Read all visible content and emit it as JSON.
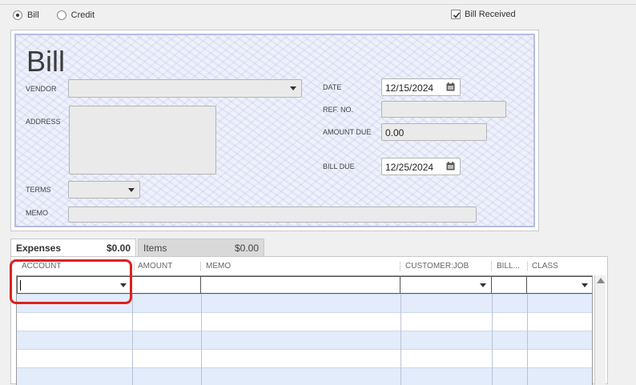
{
  "type_options": [
    {
      "label": "Bill",
      "selected": true
    },
    {
      "label": "Credit",
      "selected": false
    }
  ],
  "bill_received": {
    "label": "Bill Received",
    "checked": true
  },
  "form": {
    "title": "Bill",
    "vendor_label": "VENDOR",
    "vendor_value": "",
    "address_label": "ADDRESS",
    "terms_label": "TERMS",
    "memo_label": "MEMO",
    "date_label": "DATE",
    "date_value": "12/15/2024",
    "ref_label": "REF. NO.",
    "ref_value": "",
    "amount_due_label": "AMOUNT DUE",
    "amount_due_value": "0.00",
    "bill_due_label": "BILL DUE",
    "bill_due_value": "12/25/2024"
  },
  "tabs": [
    {
      "label": "Expenses",
      "amount": "$0.00",
      "active": true
    },
    {
      "label": "Items",
      "amount": "$0.00",
      "active": false
    }
  ],
  "grid": {
    "columns": [
      "ACCOUNT",
      "AMOUNT",
      "MEMO",
      "CUSTOMER:JOB",
      "BILL...",
      "CLASS"
    ]
  },
  "colors": {
    "highlight": "#e02020",
    "row_alt": "#e2ecfa",
    "form_border": "#b6bde0"
  }
}
